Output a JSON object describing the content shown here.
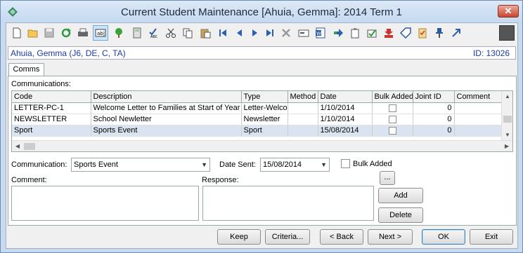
{
  "window": {
    "title": "Current Student Maintenance  [Ahuia, Gemma]:  2014 Term 1",
    "close_label": "✕"
  },
  "toolbar": {
    "icons": [
      "new-document-icon",
      "open-folder-icon",
      "save-icon",
      "refresh-icon",
      "print-icon",
      "text-field-icon",
      "tree-icon",
      "calculator-icon",
      "spell-check-icon",
      "cut-icon",
      "copy-icon",
      "paste-icon",
      "first-record-icon",
      "previous-record-icon",
      "next-record-icon",
      "last-record-icon",
      "delete-icon",
      "card-icon",
      "word-document-icon",
      "export-icon",
      "clipboard-icon",
      "approve-icon",
      "download-icon",
      "tag-icon",
      "checklist-icon",
      "pin-icon",
      "shortcut-arrow-icon"
    ],
    "active_icon": "text-field-icon"
  },
  "student": {
    "name": "Ahuia, Gemma (J6, DE, C, TA)",
    "id_text": "ID: 13026"
  },
  "tabs": [
    "Comms"
  ],
  "communications": {
    "label": "Communications:",
    "columns": [
      "Code",
      "Description",
      "Type",
      "Method",
      "Date",
      "Bulk Added",
      "Joint ID",
      "Comment"
    ],
    "rows": [
      {
        "code": "LETTER-PC-1",
        "description": "Welcome Letter to Families at Start of Year",
        "type": "Letter-Welco",
        "method": "",
        "date": "1/10/2014",
        "bulk_added": false,
        "joint_id": "0",
        "comment": ""
      },
      {
        "code": "NEWSLETTER",
        "description": "School Newletter",
        "type": "Newsletter",
        "method": "",
        "date": "1/10/2014",
        "bulk_added": false,
        "joint_id": "0",
        "comment": ""
      },
      {
        "code": "Sport",
        "description": "Sports Event",
        "type": "Sport",
        "method": "",
        "date": "15/08/2014",
        "bulk_added": false,
        "joint_id": "0",
        "comment": "",
        "selected": true
      }
    ]
  },
  "form": {
    "communication_label": "Communication:",
    "communication_value": "Sports Event",
    "date_sent_label": "Date Sent:",
    "date_sent_value": "15/08/2014",
    "bulk_added_label": "Bulk Added",
    "comment_label": "Comment:",
    "response_label": "Response:",
    "ellipsis_label": "...",
    "add_label": "Add",
    "delete_label": "Delete"
  },
  "footer": {
    "keep_label": "Keep",
    "criteria_label": "Criteria...",
    "back_label": "< Back",
    "next_label": "Next >",
    "ok_label": "OK",
    "exit_label": "Exit"
  },
  "colors": {
    "title_bg": "#c7daef",
    "link_blue": "#1a3aa8",
    "selected_row": "#d9e4f0"
  }
}
